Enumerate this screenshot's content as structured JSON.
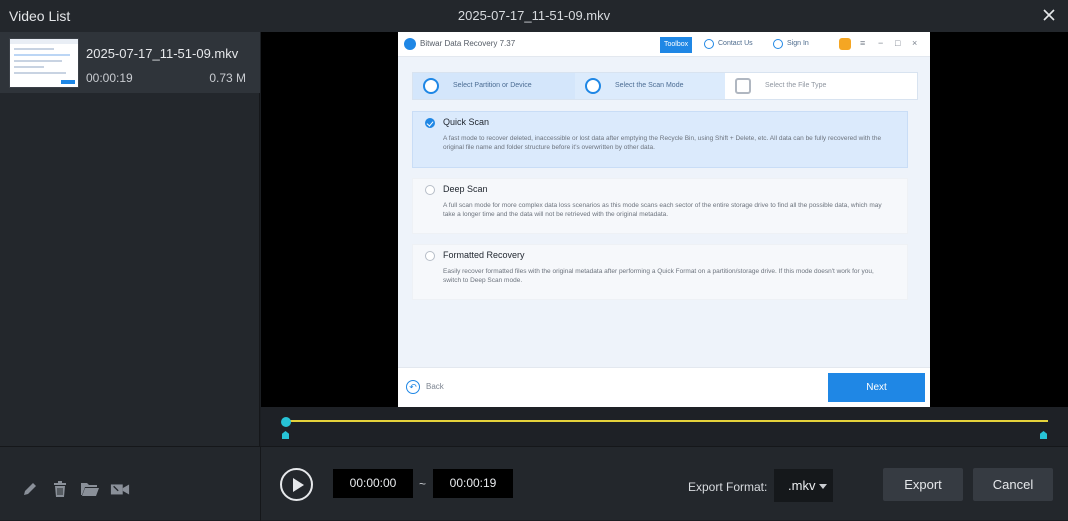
{
  "titlebar": {
    "list_title": "Video List",
    "file_title": "2025-07-17_11-51-09.mkv",
    "close_icon": "close-icon"
  },
  "video_list": [
    {
      "name": "2025-07-17_11-51-09.mkv",
      "duration": "00:00:19",
      "size": "0.73 M"
    }
  ],
  "preview": {
    "app_name": "Bitwar Data Recovery 7.37",
    "toolbox": "Toolbox",
    "contact": "Contact Us",
    "signin": "Sign In",
    "steps": [
      "Select Partition or Device",
      "Select the Scan Mode",
      "Select the File Type"
    ],
    "options": [
      {
        "title": "Quick Scan",
        "desc": "A fast mode to recover deleted, inaccessible or lost data after emptying the Recycle Bin, using Shift + Delete, etc. All data can be fully recovered with the original file name and folder structure before it's overwritten by other data.",
        "selected": true
      },
      {
        "title": "Deep Scan",
        "desc": "A full scan mode for more complex data loss scenarios as this mode scans each sector of the entire storage drive to find all the possible data, which may take a longer time and the data will not be retrieved with the original metadata.",
        "selected": false
      },
      {
        "title": "Formatted Recovery",
        "desc": "Easily recover formatted files with the original metadata after performing a Quick Format on a partition/storage drive. If this mode doesn't work for you, switch to Deep Scan mode.",
        "selected": false
      }
    ],
    "back": "Back",
    "next": "Next"
  },
  "timeline": {
    "playhead_fraction": 0.0,
    "accent": "#27c3d6",
    "track_color": "#e5d23b"
  },
  "toolbar": {
    "tools": [
      "edit-icon",
      "trash-icon",
      "folder-open-icon",
      "camera-icon"
    ],
    "start_time": "00:00:00",
    "separator": "~",
    "end_time": "00:00:19",
    "export_format_label": "Export Format:",
    "export_format_value": ".mkv",
    "export_label": "Export",
    "cancel_label": "Cancel"
  }
}
